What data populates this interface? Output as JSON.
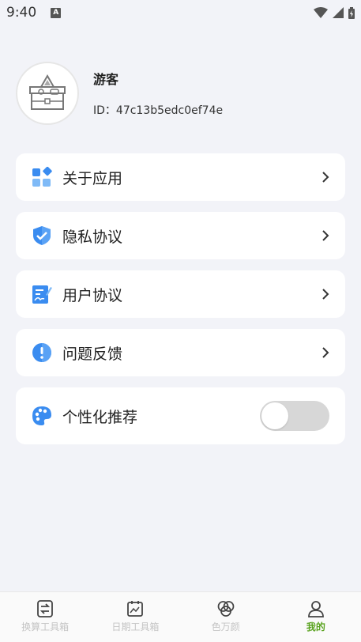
{
  "status_bar": {
    "time": "9:40",
    "notification_letter": "A"
  },
  "profile": {
    "name": "游客",
    "id_label": "ID：47c13b5edc0ef74e"
  },
  "menu": [
    {
      "label": "关于应用",
      "icon": "apps-grid-icon"
    },
    {
      "label": "隐私协议",
      "icon": "shield-check-icon"
    },
    {
      "label": "用户协议",
      "icon": "document-sign-icon"
    },
    {
      "label": "问题反馈",
      "icon": "exclamation-circle-icon"
    }
  ],
  "personalization": {
    "label": "个性化推荐",
    "enabled": false
  },
  "bottom_nav": [
    {
      "label": "换算工具箱",
      "icon": "convert-icon",
      "active": false
    },
    {
      "label": "日期工具箱",
      "icon": "calendar-icon",
      "active": false
    },
    {
      "label": "色万颜",
      "icon": "color-circles-icon",
      "active": false
    },
    {
      "label": "我的",
      "icon": "person-icon",
      "active": true
    }
  ],
  "colors": {
    "accent_green": "#5aa320",
    "icon_blue": "#3a8cf0",
    "background": "#f2f3f8"
  }
}
